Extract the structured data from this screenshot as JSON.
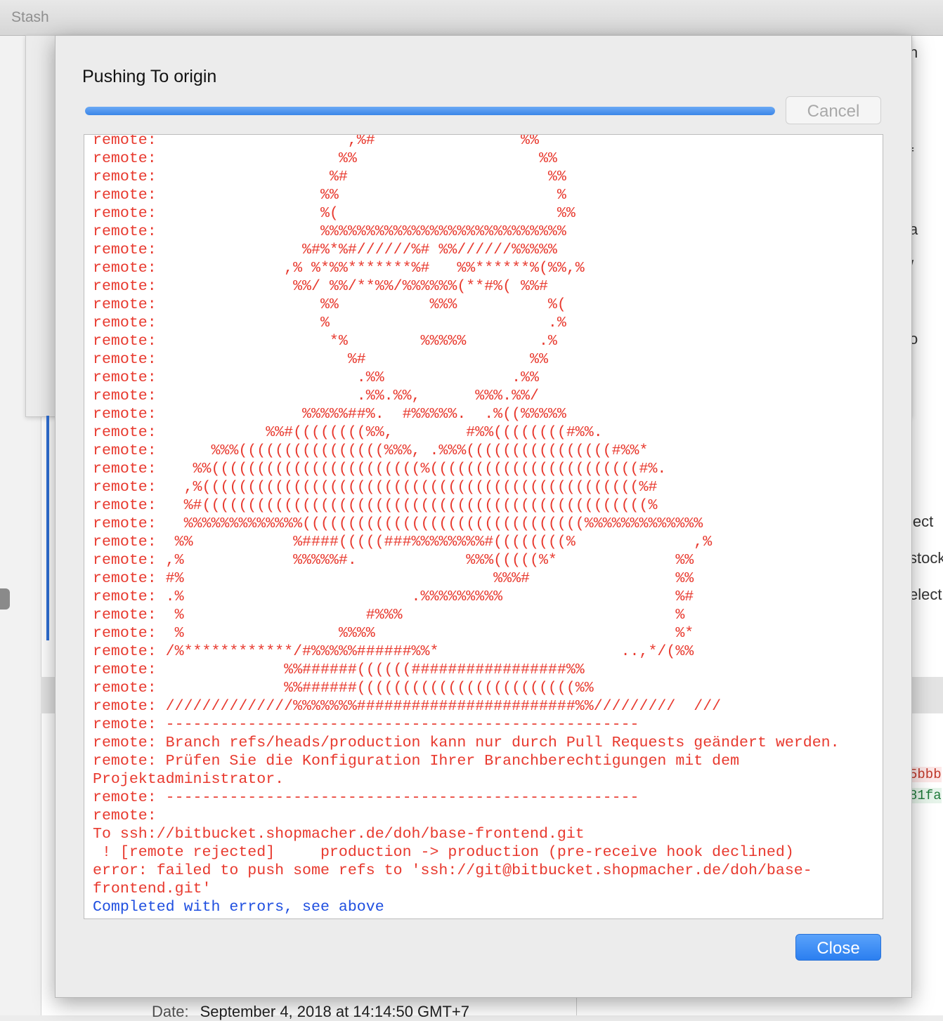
{
  "app": {
    "window_title": "Stash"
  },
  "background": {
    "right_fragments": [
      "n",
      "f",
      "a",
      "/",
      "o",
      "lect",
      "stock",
      "elect"
    ],
    "hashes": [
      "5bbb",
      "81fa"
    ],
    "date_label": "Date:",
    "date_value": "September 4, 2018 at 14:14:50 GMT+7"
  },
  "dialog": {
    "title": "Pushing To origin",
    "progress_fraction": 1.0,
    "cancel_label": "Cancel",
    "close_label": "Close",
    "colors": {
      "error_text": "#e8392e",
      "final_text": "#1f4fe0",
      "accent": "#3b86e8"
    },
    "log_lines": [
      "remote:                     ,%#                %%",
      "remote:                    %%                    %%",
      "remote:                   %#                      %%",
      "remote:                  %%                        %",
      "remote:                  %(                        %%",
      "remote:                  %%%%%%%%%%%%%%%%%%%%%%%%%%%",
      "remote:                %#%*%#//////%# %%//////%%%%%",
      "remote:              ,% %*%%*******%#   %%******%(%%,%",
      "remote:               %%/ %%/**%%/%%%%%%(**#%( %%#",
      "remote:                  %%          %%%          %(",
      "remote:                  %                        .%",
      "remote:                   *%        %%%%%        .%",
      "remote:                     %#                  %%",
      "remote:                      .%%              .%%",
      "remote:                      .%%.%%,      %%%.%%/",
      "remote:                %%%%%##%.  #%%%%%.  .%((%%%%%",
      "remote:            %%#((((((((%%,        #%%((((((((#%%.",
      "remote:      %%%((((((((((((((((%%%, .%%%((((((((((((((((#%%*",
      "remote:    %%(((((((((((((((((((((((%(((((((((((((((((((((((#%.",
      "remote:   ,%((((((((((((((((((((((((((((((((((((((((((((((((%#",
      "remote:   %#(((((((((((((((((((((((((((((((((((((((((((((((((%",
      "remote:   %%%%%%%%%%%%%(((((((((((((((((((((((((((((((%%%%%%%%%%%%%",
      "remote:  %%           %####(((((###%%%%%%%%#((((((((%             ,%",
      "remote: ,%            %%%%%#.            %%%(((((%*             %%",
      "remote: #%                                  %%%#                %%",
      "remote: .%                         .%%%%%%%%%                   %#",
      "remote:  %                    #%%%                              %",
      "remote:  %                 %%%%                                 %*",
      "remote: /%************/#%%%%%######%%*                    ..,*/(%%",
      "remote:              %%######((((((#################%%",
      "remote:              %%######((((((((((((((((((((((((%%",
      "remote: //////////////%%%%%%%########################%%/////////  ///",
      "remote: ----------------------------------------------------",
      "remote: Branch refs/heads/production kann nur durch Pull Requests geändert werden.",
      "remote: Prüfen Sie die Konfiguration Ihrer Branchberechtigungen mit dem",
      "Projektadministrator.",
      "remote: ----------------------------------------------------",
      "remote:",
      "To ssh://bitbucket.shopmacher.de/doh/base-frontend.git",
      " ! [remote rejected]     production -> production (pre-receive hook declined)",
      "error: failed to push some refs to 'ssh://git@bitbucket.shopmacher.de/doh/base-",
      "frontend.git'"
    ],
    "final_line": "Completed with errors, see above"
  }
}
